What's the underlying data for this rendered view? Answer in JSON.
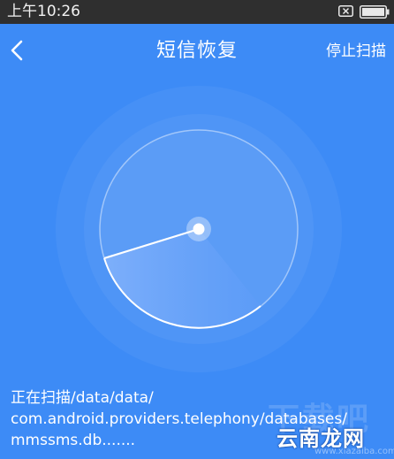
{
  "status_bar": {
    "time": "上午10:26",
    "notification_icon": "x-box-icon",
    "battery_icon": "battery-icon"
  },
  "header": {
    "back_icon": "chevron-left-icon",
    "title": "短信恢复",
    "stop_label": "停止扫描"
  },
  "scan": {
    "radar_icon": "radar-scan-icon",
    "lines": [
      "正在扫描/data/data/",
      "com.android.providers.telephony/databases/",
      "mmssms.db......."
    ]
  },
  "watermark": {
    "big_text": "下载吧",
    "site_name": "云南龙网",
    "domain": "www.xiazaiba.com"
  },
  "colors": {
    "background": "#3d8bf6",
    "status_bar": "#2f2f2f",
    "text": "#ffffff"
  }
}
